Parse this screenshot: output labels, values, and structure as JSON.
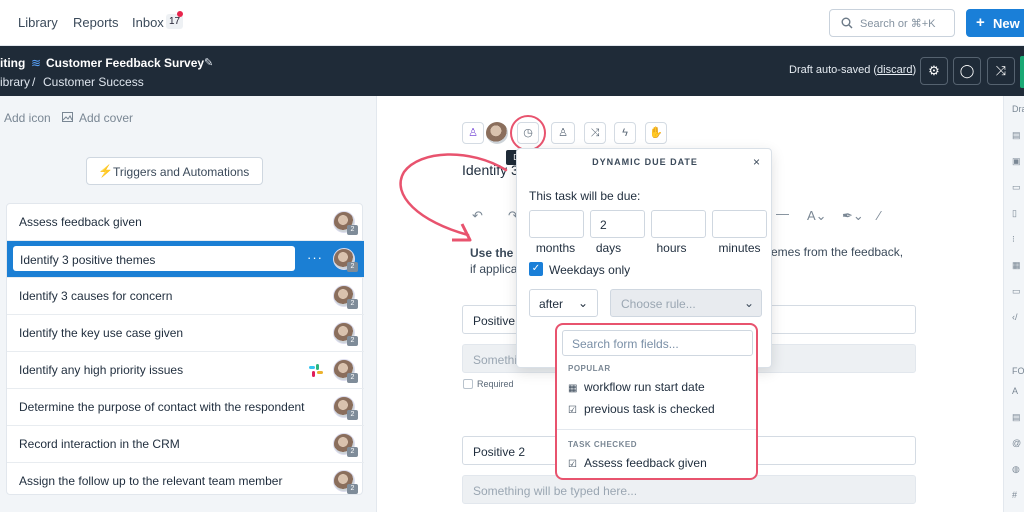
{
  "topnav": {
    "links": [
      "Library",
      "Reports",
      "Inbox"
    ],
    "inbox_count": "17",
    "search_placeholder": "Search or ⌘+K",
    "new_label": "New"
  },
  "header": {
    "title_prefix": "iting",
    "title": "Customer Feedback Survey",
    "breadcrumb": [
      "ibrary",
      "/",
      "Customer Success"
    ],
    "autosave_text": "Draft auto-saved (",
    "discard_label": "discard",
    "autosave_close": ")"
  },
  "left": {
    "add_icon_label": "Add icon",
    "add_cover_label": "Add cover",
    "triggers_label": "Triggers and Automations",
    "tasks": [
      {
        "name": "Assess feedback given",
        "badge": "2"
      },
      {
        "name": "Identify 3 positive themes",
        "badge": "2",
        "selected": true
      },
      {
        "name": "Identify 3 causes for concern",
        "badge": "2"
      },
      {
        "name": "Identify the key use case given",
        "badge": "2"
      },
      {
        "name": "Identify any high priority issues",
        "badge": "2"
      },
      {
        "name": "Determine the purpose of contact with the respondent",
        "badge": "2"
      },
      {
        "name": "Record interaction in the CRM",
        "badge": "2"
      },
      {
        "name": "Assign the follow up to the relevant team member",
        "badge": "2"
      }
    ]
  },
  "main": {
    "tooltip": "Due date",
    "task_title": "Identify 3",
    "desc_bold": "Use the f",
    "desc_line2": "if applica",
    "desc_right": "emes from the feedback,",
    "field1_value": "Positive",
    "field1_placeholder": "Somethi",
    "required_label": "Required",
    "field2_value": "Positive 2",
    "field2_placeholder": "Something will be typed here..."
  },
  "popover": {
    "title": "DYNAMIC DUE DATE",
    "close": "×",
    "label": "This task will be due:",
    "duration": [
      {
        "unit": "months",
        "value": ""
      },
      {
        "unit": "days",
        "value": "2"
      },
      {
        "unit": "hours",
        "value": ""
      },
      {
        "unit": "minutes",
        "value": ""
      }
    ],
    "weekdays_label": "Weekdays only",
    "after_value": "after",
    "rule_placeholder": "Choose rule..."
  },
  "dropdown": {
    "search_placeholder": "Search form fields...",
    "groups": [
      {
        "heading": "POPULAR",
        "items": [
          {
            "icon": "calendar-icon",
            "label": "workflow run start date"
          },
          {
            "icon": "checkbox-icon",
            "label": "previous task is checked"
          }
        ]
      },
      {
        "heading": "TASK CHECKED",
        "items": [
          {
            "icon": "checkbox-icon",
            "label": "Assess feedback given"
          }
        ]
      }
    ]
  },
  "right_strip": {
    "top_label": "Dra",
    "mid_label": "FO"
  },
  "colors": {
    "accent": "#1a7fd8",
    "dark_header": "#1f2b38",
    "highlight": "#e8536e",
    "teal": "#159b7d"
  }
}
